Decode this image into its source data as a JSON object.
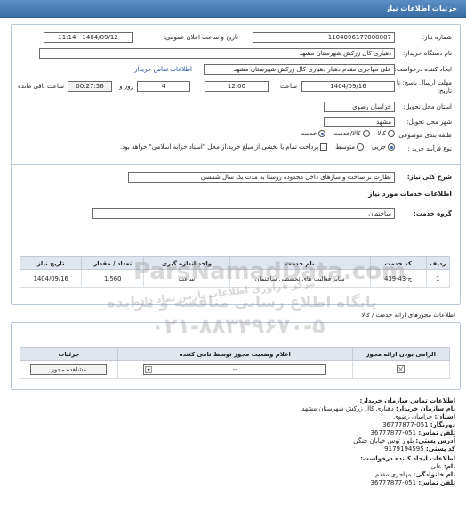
{
  "header": {
    "title": "جزئیات اطلاعات نیاز"
  },
  "need": {
    "number_label": "شماره نیاز:",
    "number_value": "1104096177000007",
    "announce_label": "تاریخ و ساعت اعلان عمومی:",
    "announce_value": "1404/09/12 - 11:14",
    "buyer_label": "نام دستگاه خریدار:",
    "buyer_value": "دهیاری کال زرکش  شهرستان مشهد",
    "creator_label": "ایجاد کننده درخواست:",
    "creator_value": "علی مهاجری مقدم دهیار دهیاری کال زرکش  شهرستان مشهد",
    "contact_link": "اطلاعات تماس خریدار",
    "deadline_label_1": "مهلت ارسال پاسخ: تا",
    "deadline_label_2": "تاریخ:",
    "deadline_date": "1404/09/16",
    "time_label": "ساعت",
    "deadline_time": "12:00",
    "days_value": "4",
    "days_label": "روز و",
    "remaining_value": "00:27:56",
    "remaining_label": "ساعت باقی مانده",
    "province_label": "استان محل تحویل:",
    "province_value": "خراسان رضوی",
    "city_label": "شهر محل تحویل:",
    "city_value": "مشهد",
    "category_label": "طبقه بندی موضوعی:",
    "category_options": [
      "کالا",
      "کالا/خدمت",
      "خدمت"
    ],
    "category_selected": "خدمت",
    "process_label": "نوع فرآیند خرید :",
    "process_options": [
      "جزیی",
      "متوسط"
    ],
    "process_selected": "جزیی",
    "payment_note": "پرداخت تمام یا بخشی از مبلغ خرید،از محل \"اسناد خزانه اسلامی\" خواهد بود."
  },
  "summary": {
    "label": "شرح کلی نیاز:",
    "value": "نظارت بر ساخت و سازهای داخل محدوده روستا به مدت یک سال شمسی"
  },
  "services": {
    "section_title": "اطلاعات خدمات مورد نیاز",
    "group_label": "گروه خدمت:",
    "group_value": "ساختمان",
    "columns": [
      "ردیف",
      "کد خدمت",
      "نام خدمت",
      "واحد اندازه گیری",
      "تعداد / مقدار",
      "تاریخ نیاز"
    ],
    "rows": [
      {
        "row": "1",
        "code": "ج-43-439",
        "name": "سایر فعالیت های تخصصی ساختمان",
        "unit": "ساعت",
        "qty": "1,560",
        "date": "1404/09/16"
      }
    ]
  },
  "permits": {
    "section_title": "اطلاعات مجوزهای ارائه خدمت / کالا",
    "columns": [
      "الزامی بودن ارائه مجوز",
      "اعلام وضعیت مجوز توسط نامی کننده",
      "جزئیات"
    ],
    "status_value": "--",
    "view_button": "مشاهده مجوز"
  },
  "buyer_contact": {
    "title": "اطلاعات تماس سازمان خریدار:",
    "lines": [
      {
        "label": "نام سازمان خریدار:",
        "value": "دهیاری کال زرکش شهرستان مشهد"
      },
      {
        "label": "استان:",
        "value": "خراسان رضوی"
      },
      {
        "label": "دورنگار:",
        "value": "051-36777877"
      },
      {
        "label": "تلفن تماس:",
        "value": "051-36777877"
      },
      {
        "label": "آدرس پستی:",
        "value": "بلوار توس خیابان جنگی"
      },
      {
        "label": "کد پستی:",
        "value": "9179194595"
      }
    ]
  },
  "creator_contact": {
    "title": "اطلاعات ایجاد کننده درخواست:",
    "lines": [
      {
        "label": "نام:",
        "value": "علی"
      },
      {
        "label": "نام خانوادگی:",
        "value": "مهاجری مقدم"
      },
      {
        "label": "تلفن تماس:",
        "value": "051-36777877"
      }
    ]
  },
  "watermark": {
    "line1": "ParsNamadData.com",
    "line2": "پایگاه اطلاع رسانی مناقصه و مزایده",
    "line3": "۰۲۱-۸۸۳۴۹۶۷۰-۵",
    "line4": "مرکز فرآوری اطلاعات پارس نماد داده"
  },
  "colors": {
    "header": "#3a6da4",
    "link": "#1f4fa8",
    "table_header": "#dfe6ee"
  }
}
